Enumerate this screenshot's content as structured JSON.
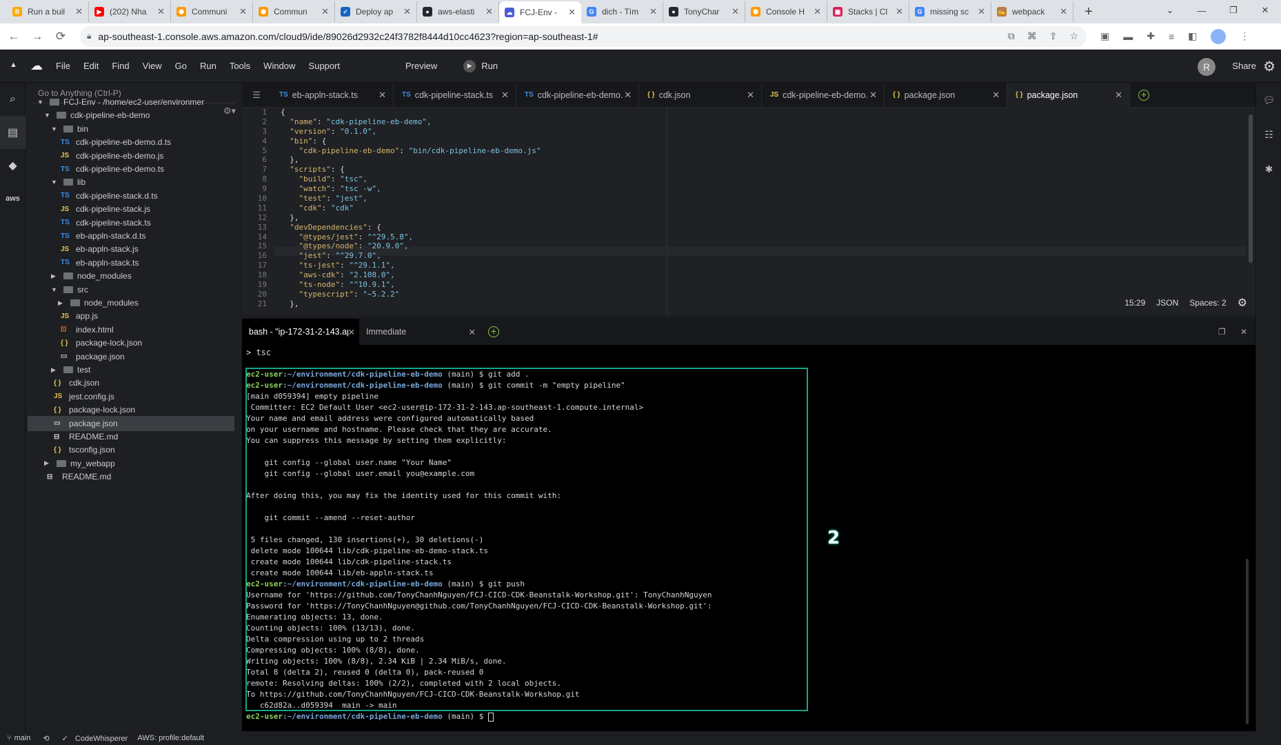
{
  "browser": {
    "tabs": [
      {
        "title": "Run a buil",
        "fav": "#f9ab00",
        "ico": "B",
        "active": false
      },
      {
        "title": "(202) Nha",
        "fav": "#ff0000",
        "ico": "▶",
        "active": false
      },
      {
        "title": "Communi",
        "fav": "#ff9900",
        "ico": "⬢",
        "active": false
      },
      {
        "title": "Commun",
        "fav": "#ff9900",
        "ico": "⬢",
        "active": false
      },
      {
        "title": "Deploy ap",
        "fav": "#1565c0",
        "ico": "✓",
        "active": false
      },
      {
        "title": "aws-elasti",
        "fav": "#24292f",
        "ico": "●",
        "active": false
      },
      {
        "title": "FCJ-Env -",
        "fav": "#4a5bd6",
        "ico": "☁",
        "active": true
      },
      {
        "title": "dich - Tìm",
        "fav": "#4285f4",
        "ico": "G",
        "active": false
      },
      {
        "title": "TonyChar",
        "fav": "#24292f",
        "ico": "●",
        "active": false
      },
      {
        "title": "Console H",
        "fav": "#ff9900",
        "ico": "⬢",
        "active": false
      },
      {
        "title": "Stacks | Cl",
        "fav": "#d6245c",
        "ico": "▣",
        "active": false
      },
      {
        "title": "missing sc",
        "fav": "#4285f4",
        "ico": "G",
        "active": false
      },
      {
        "title": "webpack",
        "fav": "#c07a3a",
        "ico": "✍",
        "active": false
      }
    ],
    "url": "ap-southeast-1.console.aws.amazon.com/cloud9/ide/89026d2932c24f3782f8444d10cc4623?region=ap-southeast-1#"
  },
  "ide": {
    "menu": [
      "File",
      "Edit",
      "Find",
      "View",
      "Go",
      "Run",
      "Tools",
      "Window",
      "Support"
    ],
    "preview": "Preview",
    "run": "Run",
    "user_initial": "R",
    "share": "Share",
    "goto_placeholder": "Go to Anything (Ctrl-P)",
    "tree": [
      {
        "depth": 0,
        "type": "dir",
        "open": true,
        "name": "FCJ-Env - /home/ec2-user/environmer"
      },
      {
        "depth": 1,
        "type": "dir",
        "open": true,
        "name": "cdk-pipeline-eb-demo"
      },
      {
        "depth": 2,
        "type": "dir",
        "open": true,
        "name": "bin"
      },
      {
        "depth": 3,
        "type": "ts",
        "name": "cdk-pipeline-eb-demo.d.ts"
      },
      {
        "depth": 3,
        "type": "js",
        "name": "cdk-pipeline-eb-demo.js"
      },
      {
        "depth": 3,
        "type": "ts",
        "name": "cdk-pipeline-eb-demo.ts"
      },
      {
        "depth": 2,
        "type": "dir",
        "open": true,
        "name": "lib"
      },
      {
        "depth": 3,
        "type": "ts",
        "name": "cdk-pipeline-stack.d.ts"
      },
      {
        "depth": 3,
        "type": "js",
        "name": "cdk-pipeline-stack.js"
      },
      {
        "depth": 3,
        "type": "ts",
        "name": "cdk-pipeline-stack.ts"
      },
      {
        "depth": 3,
        "type": "ts",
        "name": "eb-appln-stack.d.ts"
      },
      {
        "depth": 3,
        "type": "js",
        "name": "eb-appln-stack.js"
      },
      {
        "depth": 3,
        "type": "ts",
        "name": "eb-appln-stack.ts"
      },
      {
        "depth": 2,
        "type": "dir",
        "open": false,
        "name": "node_modules"
      },
      {
        "depth": 2,
        "type": "dir",
        "open": true,
        "name": "src"
      },
      {
        "depth": 3,
        "type": "dir",
        "open": false,
        "name": "node_modules"
      },
      {
        "depth": 3,
        "type": "js",
        "name": "app.js"
      },
      {
        "depth": 3,
        "type": "html",
        "name": "index.html"
      },
      {
        "depth": 3,
        "type": "json",
        "name": "package-lock.json"
      },
      {
        "depth": 3,
        "type": "npm",
        "name": "package.json"
      },
      {
        "depth": 2,
        "type": "dir",
        "open": false,
        "name": "test"
      },
      {
        "depth": 2,
        "type": "json",
        "name": "cdk.json"
      },
      {
        "depth": 2,
        "type": "js",
        "name": "jest.config.js"
      },
      {
        "depth": 2,
        "type": "json",
        "name": "package-lock.json"
      },
      {
        "depth": 2,
        "type": "npm",
        "name": "package.json",
        "selected": true
      },
      {
        "depth": 2,
        "type": "md",
        "name": "README.md"
      },
      {
        "depth": 2,
        "type": "json",
        "name": "tsconfig.json"
      },
      {
        "depth": 1,
        "type": "dir",
        "open": false,
        "name": "my_webapp"
      },
      {
        "depth": 1,
        "type": "md",
        "name": "README.md"
      }
    ],
    "editor_tabs": [
      {
        "icon": "TS",
        "label": "eb-appln-stack.ts",
        "active": false
      },
      {
        "icon": "TS",
        "label": "cdk-pipeline-stack.ts",
        "active": false
      },
      {
        "icon": "TS",
        "label": "cdk-pipeline-eb-demo.",
        "active": false
      },
      {
        "icon": "{}",
        "label": "cdk.json",
        "active": false
      },
      {
        "icon": "JS",
        "label": "cdk-pipeline-eb-demo.",
        "active": false
      },
      {
        "icon": "{}",
        "label": "package.json",
        "active": false
      },
      {
        "icon": "{}",
        "label": "package.json",
        "active": true
      }
    ],
    "code_lines": [
      "{",
      "  \"name\": \"cdk-pipeline-eb-demo\",",
      "  \"version\": \"0.1.0\",",
      "  \"bin\": {",
      "    \"cdk-pipeline-eb-demo\": \"bin/cdk-pipeline-eb-demo.js\"",
      "  },",
      "  \"scripts\": {",
      "    \"build\": \"tsc\",",
      "    \"watch\": \"tsc -w\",",
      "    \"test\": \"jest\",",
      "    \"cdk\": \"cdk\"",
      "  },",
      "  \"devDependencies\": {",
      "    \"@types/jest\": \"^29.5.8\",",
      "    \"@types/node\": \"20.9.0\",",
      "    \"jest\": \"^29.7.0\",",
      "    \"ts-jest\": \"^29.1.1\",",
      "    \"aws-cdk\": \"2.108.0\",",
      "    \"ts-node\": \"^10.9.1\",",
      "    \"typescript\": \"~5.2.2\"",
      "  },"
    ],
    "editor_status": {
      "cursor": "15:29",
      "lang": "JSON",
      "spaces": "Spaces: 2"
    },
    "term_tabs": [
      {
        "label": "bash - \"ip-172-31-2-143.ap",
        "active": true
      },
      {
        "label": "Immediate",
        "active": false
      }
    ],
    "term_header": "> tsc",
    "prompt_user": "ec2-user",
    "prompt_path": ":~/environment/cdk-pipeline-eb-demo",
    "terminal_lines": [
      {
        "prompt": true,
        "cmd": " (main) $ git add ."
      },
      {
        "prompt": true,
        "cmd": " (main) $ git commit -m \"empty pipeline\""
      },
      {
        "text": "[main d059394] empty pipeline"
      },
      {
        "text": " Committer: EC2 Default User <ec2-user@ip-172-31-2-143.ap-southeast-1.compute.internal>"
      },
      {
        "text": "Your name and email address were configured automatically based"
      },
      {
        "text": "on your username and hostname. Please check that they are accurate."
      },
      {
        "text": "You can suppress this message by setting them explicitly:"
      },
      {
        "text": ""
      },
      {
        "text": "    git config --global user.name \"Your Name\""
      },
      {
        "text": "    git config --global user.email you@example.com"
      },
      {
        "text": ""
      },
      {
        "text": "After doing this, you may fix the identity used for this commit with:"
      },
      {
        "text": ""
      },
      {
        "text": "    git commit --amend --reset-author"
      },
      {
        "text": ""
      },
      {
        "text": " 5 files changed, 130 insertions(+), 30 deletions(-)"
      },
      {
        "text": " delete mode 100644 lib/cdk-pipeline-eb-demo-stack.ts"
      },
      {
        "text": " create mode 100644 lib/cdk-pipeline-stack.ts"
      },
      {
        "text": " create mode 100644 lib/eb-appln-stack.ts"
      },
      {
        "prompt": true,
        "cmd": " (main) $ git push"
      },
      {
        "text": "Username for 'https://github.com/TonyChanhNguyen/FCJ-CICD-CDK-Beanstalk-Workshop.git': TonyChanhNguyen"
      },
      {
        "text": "Password for 'https://TonyChanhNguyen@github.com/TonyChanhNguyen/FCJ-CICD-CDK-Beanstalk-Workshop.git':"
      },
      {
        "text": "Enumerating objects: 13, done."
      },
      {
        "text": "Counting objects: 100% (13/13), done."
      },
      {
        "text": "Delta compression using up to 2 threads"
      },
      {
        "text": "Compressing objects: 100% (8/8), done."
      },
      {
        "text": "Writing objects: 100% (8/8), 2.34 KiB | 2.34 MiB/s, done."
      },
      {
        "text": "Total 8 (delta 2), reused 0 (delta 0), pack-reused 0"
      },
      {
        "text": "remote: Resolving deltas: 100% (2/2), completed with 2 local objects."
      },
      {
        "text": "To https://github.com/TonyChanhNguyen/FCJ-CICD-CDK-Beanstalk-Workshop.git"
      },
      {
        "text": "   c62d82a..d059394  main -> main"
      },
      {
        "prompt": true,
        "cmd": " (main) $ ",
        "cursor": true
      }
    ],
    "annotation_badge": "2",
    "status": {
      "branch": "main",
      "codewhisperer": "CodeWhisperer",
      "aws": "AWS: profile:default"
    }
  }
}
